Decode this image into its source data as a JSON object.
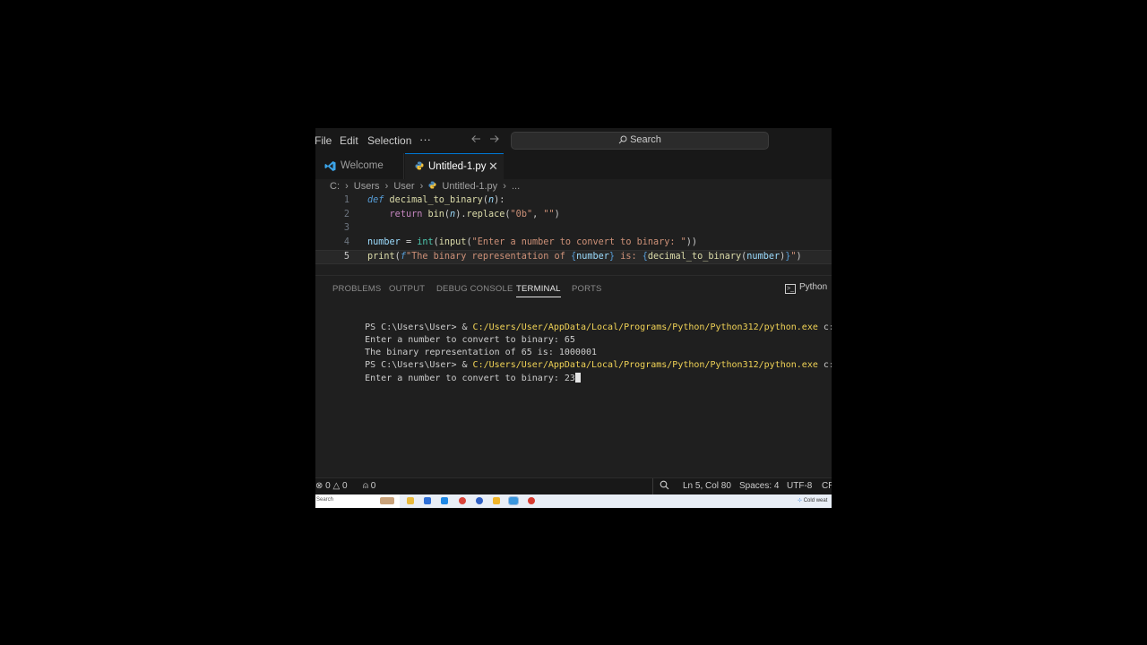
{
  "menu": {
    "file": "File",
    "edit": "Edit",
    "selection": "Selection",
    "more": "···",
    "back_icon": "arrow-left-icon",
    "forward_icon": "arrow-right-icon"
  },
  "search": {
    "label": "Search"
  },
  "tabs": [
    {
      "label": "Welcome",
      "icon": "vscode-logo-icon"
    },
    {
      "label": "Untitled-1.py",
      "icon": "python-icon",
      "close": "✕"
    }
  ],
  "breadcrumb": [
    "C:",
    "›",
    "Users",
    "›",
    "User",
    "›",
    "Untitled-1.py",
    "›",
    "..."
  ],
  "editor": {
    "line_numbers": [
      "1",
      "2",
      "3",
      "4",
      "5"
    ],
    "lines": [
      [
        {
          "t": "def",
          "c": "kw"
        },
        {
          "t": " ",
          "c": ""
        },
        {
          "t": "decimal_to_binary",
          "c": "fn"
        },
        {
          "t": "(",
          "c": ""
        },
        {
          "t": "n",
          "c": "param"
        },
        {
          "t": "):",
          "c": ""
        }
      ],
      [
        {
          "t": "    ",
          "c": ""
        },
        {
          "t": "return",
          "c": "ctl"
        },
        {
          "t": " ",
          "c": ""
        },
        {
          "t": "bin",
          "c": "fn"
        },
        {
          "t": "(",
          "c": ""
        },
        {
          "t": "n",
          "c": "param"
        },
        {
          "t": ").",
          "c": ""
        },
        {
          "t": "replace",
          "c": "fn"
        },
        {
          "t": "(",
          "c": ""
        },
        {
          "t": "\"0b\"",
          "c": "str"
        },
        {
          "t": ", ",
          "c": ""
        },
        {
          "t": "\"\"",
          "c": "str"
        },
        {
          "t": ")",
          "c": ""
        }
      ],
      [],
      [
        {
          "t": "number",
          "c": "var"
        },
        {
          "t": " = ",
          "c": "op"
        },
        {
          "t": "int",
          "c": "bi"
        },
        {
          "t": "(",
          "c": ""
        },
        {
          "t": "input",
          "c": "fn"
        },
        {
          "t": "(",
          "c": ""
        },
        {
          "t": "\"Enter a number to convert to binary: \"",
          "c": "str"
        },
        {
          "t": "))",
          "c": ""
        }
      ],
      [
        {
          "t": "print",
          "c": "fn"
        },
        {
          "t": "(",
          "c": ""
        },
        {
          "t": "f",
          "c": "kw"
        },
        {
          "t": "\"The binary representation of ",
          "c": "str"
        },
        {
          "t": "{",
          "c": "brace"
        },
        {
          "t": "number",
          "c": "var"
        },
        {
          "t": "}",
          "c": "brace"
        },
        {
          "t": " is: ",
          "c": "str"
        },
        {
          "t": "{",
          "c": "brace"
        },
        {
          "t": "decimal_to_binary",
          "c": "fn"
        },
        {
          "t": "(",
          "c": ""
        },
        {
          "t": "number",
          "c": "var"
        },
        {
          "t": ")",
          "c": ""
        },
        {
          "t": "}",
          "c": "brace"
        },
        {
          "t": "\"",
          "c": "str"
        },
        {
          "t": ")",
          "c": ""
        }
      ]
    ]
  },
  "panel": {
    "tabs": [
      "PROBLEMS",
      "OUTPUT",
      "DEBUG CONSOLE",
      "TERMINAL",
      "PORTS"
    ],
    "active_tab": "TERMINAL",
    "terminal_name": "Python"
  },
  "terminal": {
    "lines": [
      {
        "prompt": "PS C:\\Users\\User> & ",
        "path": "C:/Users/User/AppData/Local/Programs/Python/Python312/python.exe",
        "rest": " c:/Users/U"
      },
      {
        "text": "Enter a number to convert to binary: 65"
      },
      {
        "text": "The binary representation of 65 is: 1000001"
      },
      {
        "prompt": "PS C:\\Users\\User> & ",
        "path": "C:/Users/User/AppData/Local/Programs/Python/Python312/python.exe",
        "rest": " c:/Users/U"
      },
      {
        "text": "Enter a number to convert to binary: 23",
        "cursor": true
      }
    ]
  },
  "status": {
    "errors": "0",
    "warnings": "0",
    "ports": "0",
    "position": "Ln 5, Col 80",
    "spaces": "Spaces: 4",
    "encoding": "UTF-8",
    "eol": "CR"
  },
  "taskbar": {
    "search_text": "Search",
    "weather_text": "Cold weat"
  }
}
